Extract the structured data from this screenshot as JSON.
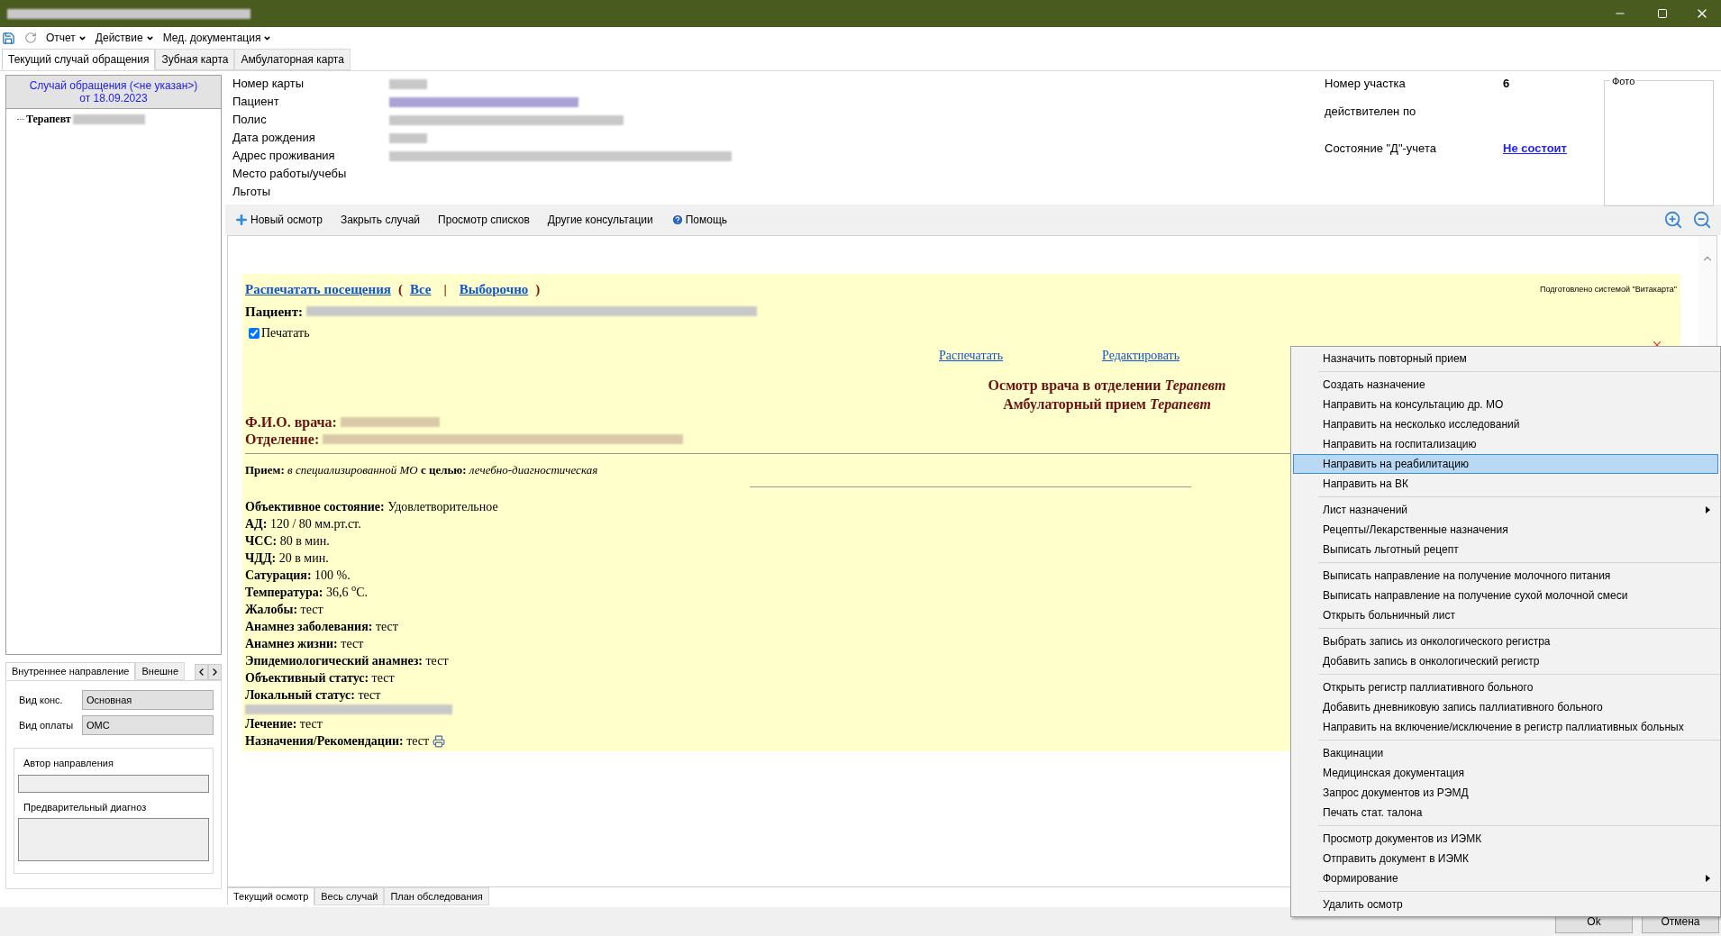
{
  "menu": [
    {
      "label": "Отчет"
    },
    {
      "label": "Действие"
    },
    {
      "label": "Мед. документация"
    }
  ],
  "main_tabs": [
    {
      "label": "Текущий случай обращения",
      "selected": true
    },
    {
      "label": "Зубная карта",
      "selected": false
    },
    {
      "label": "Амбулаторная карта",
      "selected": false
    }
  ],
  "case_header": {
    "title": "Случай обращения (<не указан>)",
    "date": "от 18.09.2023"
  },
  "tree": [
    {
      "label": "Терапевт"
    }
  ],
  "patient_fields": [
    {
      "label": "Номер карты"
    },
    {
      "label": "Пациент"
    },
    {
      "label": "Полис"
    },
    {
      "label": "Дата рождения"
    },
    {
      "label": "Адрес проживания"
    },
    {
      "label": "Место работы/учебы"
    },
    {
      "label": "Льготы"
    }
  ],
  "right_fields": [
    {
      "label": "Номер участка",
      "value": "6",
      "kind": "bold"
    },
    {
      "label": "действителен по",
      "kind": "empty"
    },
    {
      "label": "Состояние \"Д\"-учета",
      "value": "Не состоит",
      "kind": "link"
    }
  ],
  "photo": {
    "label": "Фото"
  },
  "toolbar": [
    {
      "label": "Новый осмотр",
      "kind": "add"
    },
    {
      "label": "Закрыть случай",
      "kind": "plain"
    },
    {
      "label": "Просмотр списков",
      "kind": "plain"
    },
    {
      "label": "Другие консультации",
      "kind": "plain"
    },
    {
      "label": "Помощь",
      "kind": "help"
    }
  ],
  "document": {
    "print_links": {
      "main": "Распечатать посещения",
      "open": "(",
      "all": "Все",
      "sep": "|",
      "selective": "Выборочно",
      "close": ")"
    },
    "prepared_by": "Подготовлено системой \"Витакарта\"",
    "patient_label": "Пациент:",
    "print_checkbox": {
      "label": "Печатать",
      "checked": true
    },
    "actions": [
      "Распечатать",
      "Редактировать"
    ],
    "headings": [
      "Осмотр врача в отделении *Терапевт*",
      "Амбулаторный прием *Терапевт*"
    ],
    "doctor_label": "Ф.И.О. врача:",
    "department_label": "Отделение:",
    "visit": "**Прием:** *в специализированной МО* **с целью:** *лечебно-диагностическая*",
    "lines": [
      {
        "kind": "text",
        "text": "**Объективное состояние:** Удовлетворительное"
      },
      {
        "kind": "text",
        "text": "**АД:** 120 / 80 мм.рт.ст."
      },
      {
        "kind": "text",
        "text": "**ЧСС:** 80 в мин."
      },
      {
        "kind": "text",
        "text": "**ЧДД:** 20 в мин."
      },
      {
        "kind": "text",
        "text": "**Сатурация:** 100 %."
      },
      {
        "kind": "text",
        "text": "**Температура:** 36,6 $^{o}$С."
      },
      {
        "kind": "text",
        "text": "**Жалобы:** тест"
      },
      {
        "kind": "text",
        "text": "**Анамнез заболевания:** тест"
      },
      {
        "kind": "text",
        "text": "**Анамнез жизни:** тест"
      },
      {
        "kind": "text",
        "text": "**Эпидемиологический анамнез:** тест"
      },
      {
        "kind": "text",
        "text": "**Объективный статус:** тест"
      },
      {
        "kind": "text",
        "text": "**Локальный статус:** тест"
      },
      {
        "kind": "redacted"
      },
      {
        "kind": "text",
        "text": "**Лечение:** тест"
      },
      {
        "kind": "printable",
        "text": "**Назначения/Рекомендации:** тест"
      }
    ]
  },
  "bottom_tabs": [
    {
      "label": "Текущий осмотр",
      "selected": true
    },
    {
      "label": "Весь случай",
      "selected": false
    },
    {
      "label": "План обследования",
      "selected": false
    }
  ],
  "referral": {
    "tabs": [
      {
        "label": "Внутреннее направление",
        "selected": true
      },
      {
        "label": "Внешне",
        "selected": false
      }
    ],
    "fields": [
      {
        "label": "Вид конс.",
        "value": "Основная"
      },
      {
        "label": "Вид оплаты",
        "value": "ОМС"
      }
    ],
    "author_label": "Автор направления",
    "diagnosis_label": "Предварительный диагноз"
  },
  "context_menu": [
    [
      {
        "label": "Назначить повторный прием",
        "selected": false,
        "submenu": false
      }
    ],
    [
      {
        "label": "Создать назначение",
        "selected": false,
        "submenu": false
      },
      {
        "label": "Направить на консультацию др. МО",
        "selected": false,
        "submenu": false
      },
      {
        "label": "Направить на несколько исследований",
        "selected": false,
        "submenu": false
      },
      {
        "label": "Направить на госпитализацию",
        "selected": false,
        "submenu": false
      },
      {
        "label": "Направить на реабилитацию",
        "selected": true,
        "submenu": false
      },
      {
        "label": "Направить на ВК",
        "selected": false,
        "submenu": false
      }
    ],
    [
      {
        "label": "Лист назначений",
        "selected": false,
        "submenu": true
      },
      {
        "label": "Рецепты/Лекарственные назначения",
        "selected": false,
        "submenu": false
      },
      {
        "label": "Выписать льготный рецепт",
        "selected": false,
        "submenu": false
      }
    ],
    [
      {
        "label": "Выписать направление на получение молочного питания",
        "selected": false,
        "submenu": false
      },
      {
        "label": "Выписать направление на получение сухой молочной смеси",
        "selected": false,
        "submenu": false
      },
      {
        "label": "Открыть больничный лист",
        "selected": false,
        "submenu": false
      }
    ],
    [
      {
        "label": "Выбрать запись из онкологического регистра",
        "selected": false,
        "submenu": false
      },
      {
        "label": "Добавить запись в онкологический регистр",
        "selected": false,
        "submenu": false
      }
    ],
    [
      {
        "label": "Открыть регистр паллиативного больного",
        "selected": false,
        "submenu": false
      },
      {
        "label": "Добавить дневниковую запись паллиативного больного",
        "selected": false,
        "submenu": false
      },
      {
        "label": "Направить на включение/исключение в регистр паллиативных больных",
        "selected": false,
        "submenu": false
      }
    ],
    [
      {
        "label": "Вакцинации",
        "selected": false,
        "submenu": false
      },
      {
        "label": "Медицинская документация",
        "selected": false,
        "submenu": false
      },
      {
        "label": "Запрос документов из РЭМД",
        "selected": false,
        "submenu": false
      },
      {
        "label": "Печать стат. талона",
        "selected": false,
        "submenu": false
      }
    ],
    [
      {
        "label": "Просмотр документов из ИЭМК",
        "selected": false,
        "submenu": false
      },
      {
        "label": "Отправить документ в ИЭМК",
        "selected": false,
        "submenu": false
      },
      {
        "label": "Формирование",
        "selected": false,
        "submenu": true
      }
    ],
    [
      {
        "label": "Удалить осмотр",
        "selected": false,
        "submenu": false
      }
    ]
  ],
  "buttons": [
    "Ok",
    "Отмена"
  ]
}
